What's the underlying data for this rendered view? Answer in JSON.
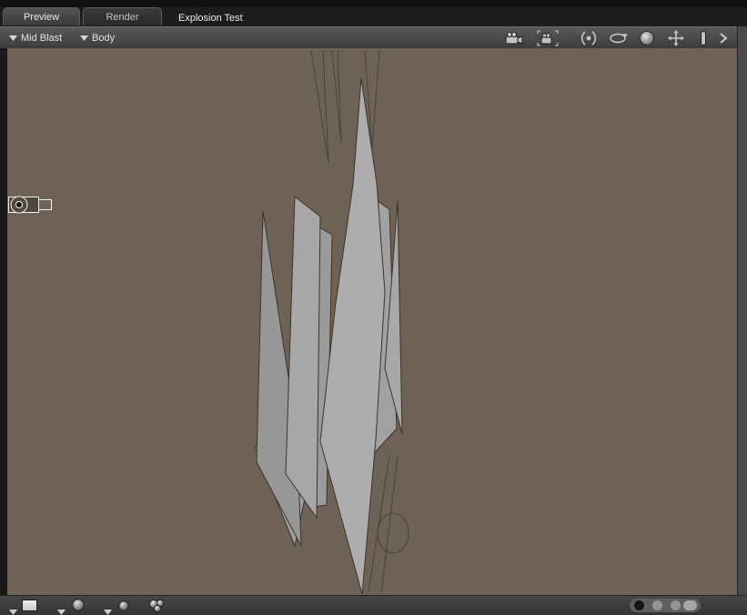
{
  "window": {
    "pane_title": "Explosion Test"
  },
  "tabs": [
    {
      "label": "Preview",
      "active": true
    },
    {
      "label": "Render",
      "active": false
    }
  ],
  "toolbar": {
    "node_dropdown": "Mid Blast",
    "part_dropdown": "Body",
    "icons": [
      "camera-icon",
      "frame-camera-icon",
      "orbit-camera-icon",
      "rotate-camera-icon",
      "sphere-icon",
      "pan-camera-icon",
      "dolly-camera-icon",
      "chevron-right-icon"
    ]
  },
  "viewport": {
    "content": "gray faceted explosion mesh of vertical spikes with wireframe spikes above, wire circle below, and a camera gizmo at left"
  },
  "bottom_bar": {
    "icons": [
      "drawstyle-swatch-dropdown",
      "shaded-sphere-dropdown",
      "smooth-sphere-dropdown",
      "multi-sphere-icon"
    ],
    "pager_dots": 3
  },
  "colors": {
    "viewport_bg": "#6e6257",
    "mesh_fill": "#a8a8a8",
    "mesh_stroke": "#3b342b",
    "toolbar_bg": "#4a4a4a",
    "tabbar_bg": "#1d1d1d",
    "gizmo_stroke": "#f2f2f2"
  }
}
